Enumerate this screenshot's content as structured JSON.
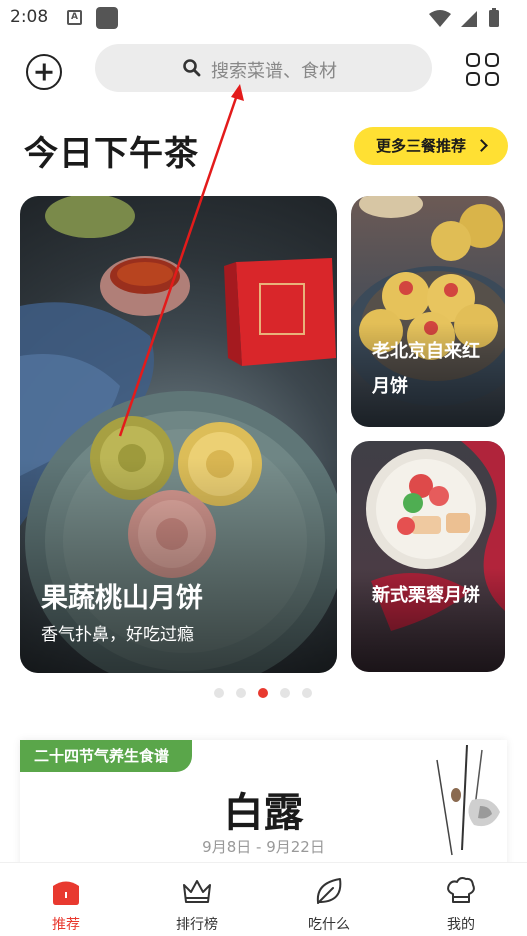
{
  "status_bar": {
    "time": "2:08"
  },
  "search": {
    "placeholder": "搜索菜谱、食材"
  },
  "heading": {
    "title": "今日下午茶",
    "more_label": "更多三餐推荐"
  },
  "cards": {
    "main": {
      "title": "果蔬桃山月饼",
      "subtitle": "香气扑鼻，好吃过瘾"
    },
    "side_top": {
      "title": "老北京自来红月饼"
    },
    "side_bottom": {
      "title": "新式栗蓉月饼"
    }
  },
  "carousel": {
    "page_count": 5,
    "active_index": 2
  },
  "solar_term": {
    "tag": "二十四节气养生食谱",
    "name": "白露",
    "dates": "9月8日 - 9月22日"
  },
  "tabs": [
    {
      "label": "推荐",
      "icon": "home-icon",
      "active": true
    },
    {
      "label": "排行榜",
      "icon": "crown-icon",
      "active": false
    },
    {
      "label": "吃什么",
      "icon": "leaf-icon",
      "active": false
    },
    {
      "label": "我的",
      "icon": "chef-hat-icon",
      "active": false
    }
  ],
  "colors": {
    "accent": "#e8392f",
    "yellow": "#ffe033",
    "green": "#5aa64a",
    "search_bg": "#ececec"
  }
}
